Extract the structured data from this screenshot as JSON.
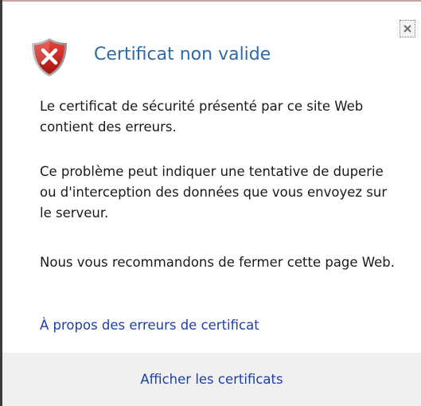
{
  "dialog": {
    "title": "Certificat non valide",
    "paragraph_1": "Le certificat de sécurité présenté par ce site Web contient des erreurs.",
    "paragraph_2": "Ce problème peut indiquer une tentative de duperie ou d'interception des données que vous envoyez sur le serveur.",
    "paragraph_3": "Nous vous recommandons de fermer cette page Web.",
    "link_text": "À propos des erreurs de certificat",
    "footer_button_label": "Afficher les certificats"
  },
  "icons": {
    "header_icon": "shield-error-icon",
    "close_icon": "close-icon"
  },
  "colors": {
    "title": "#2d6aa8",
    "link": "#1f3fa8",
    "shield_red": "#c8201c",
    "footer_bg": "#f0f0f0"
  }
}
